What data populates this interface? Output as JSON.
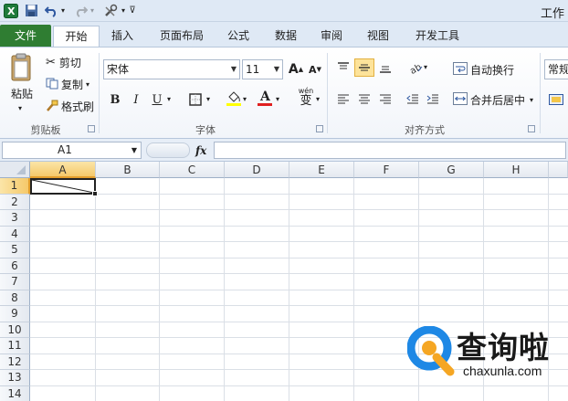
{
  "titlebar": {
    "app_icon": "excel-icon",
    "window_title": "工作"
  },
  "tabs": [
    {
      "label": "文件"
    },
    {
      "label": "开始"
    },
    {
      "label": "插入"
    },
    {
      "label": "页面布局"
    },
    {
      "label": "公式"
    },
    {
      "label": "数据"
    },
    {
      "label": "审阅"
    },
    {
      "label": "视图"
    },
    {
      "label": "开发工具"
    }
  ],
  "ribbon": {
    "clipboard": {
      "paste": "粘贴",
      "cut": "剪切",
      "copy": "复制",
      "format_painter": "格式刷",
      "group": "剪贴板"
    },
    "font": {
      "name": "宋体",
      "size": "11",
      "group": "字体",
      "bold": "B",
      "italic": "I",
      "underline": "U",
      "font_color_glyph": "A",
      "highlight_color": "#ffff00",
      "font_color": "#e02020",
      "phonetic": "wén"
    },
    "alignment": {
      "wrap_text": "自动换行",
      "merge_center": "合并后居中",
      "group": "对齐方式"
    },
    "number": {
      "format": "常规"
    }
  },
  "formula_bar": {
    "name_box": "A1",
    "fx": "fx",
    "formula": ""
  },
  "sheet": {
    "columns": [
      "A",
      "B",
      "C",
      "D",
      "E",
      "F",
      "G",
      "H"
    ],
    "rows": [
      "1",
      "2",
      "3",
      "4",
      "5",
      "6",
      "7",
      "8",
      "9",
      "10",
      "11",
      "12",
      "13",
      "14"
    ],
    "selected_cell": "A1"
  },
  "watermark": {
    "title": "查询啦",
    "url": "chaxunla.com"
  }
}
